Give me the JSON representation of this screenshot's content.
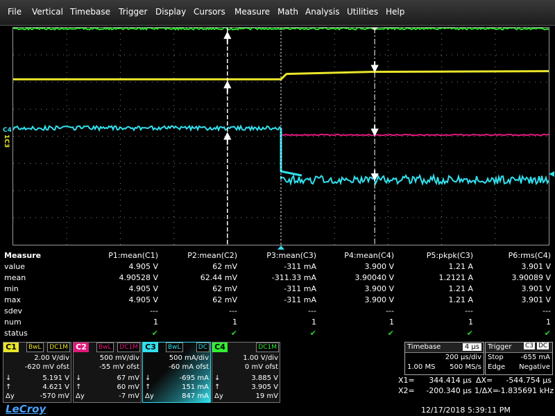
{
  "menu": [
    "File",
    "Vertical",
    "Timebase",
    "Trigger",
    "Display",
    "Cursors",
    "Measure",
    "Math",
    "Analysis",
    "Utilities",
    "Help"
  ],
  "grid": {
    "rows": 8,
    "cols": 10,
    "axis_label_c4": "C4",
    "axis_label_c1c3": "1C3",
    "trigger_marker": "trigger-arrow"
  },
  "waveforms": {
    "c2": {
      "color": "#33ee33",
      "level_div": 0.03
    },
    "c1": {
      "color": "#e9e52a",
      "before_div": 1.9,
      "after_div": 1.6
    },
    "c3": {
      "color": "#33e0ee",
      "before_div": 3.7,
      "after_div": 5.6
    },
    "c4": {
      "color": "#e0187a",
      "level_div": 3.95
    },
    "trigger_time_div": 5.0,
    "cursor1_div": 4.0,
    "cursor2_div": 6.75
  },
  "measure": {
    "title": "Measure",
    "headers": [
      "P1:mean(C1)",
      "P2:mean(C2)",
      "P3:mean(C3)",
      "P4:mean(C4)",
      "P5:pkpk(C3)",
      "P6:rms(C4)"
    ],
    "rows": [
      {
        "label": "value",
        "cells": [
          "4.905 V",
          "62 mV",
          "-311 mA",
          "3.900 V",
          "1.21 A",
          "3.901 V"
        ]
      },
      {
        "label": "mean",
        "cells": [
          "4.90528 V",
          "62.44 mV",
          "-311.33 mA",
          "3.90040 V",
          "1.2121 A",
          "3.90089 V"
        ]
      },
      {
        "label": "min",
        "cells": [
          "4.905 V",
          "62 mV",
          "-311 mA",
          "3.900 V",
          "1.21 A",
          "3.901 V"
        ]
      },
      {
        "label": "max",
        "cells": [
          "4.905 V",
          "62 mV",
          "-311 mA",
          "3.900 V",
          "1.21 A",
          "3.901 V"
        ]
      },
      {
        "label": "sdev",
        "cells": [
          "---",
          "---",
          "---",
          "---",
          "---",
          "---"
        ]
      },
      {
        "label": "num",
        "cells": [
          "1",
          "1",
          "1",
          "1",
          "1",
          "1"
        ]
      },
      {
        "label": "status",
        "cells": [
          "✔",
          "✔",
          "✔",
          "✔",
          "✔",
          "✔"
        ]
      }
    ]
  },
  "channels": [
    {
      "tag": "C1",
      "color": "#e9e52a",
      "bwl": "BwL",
      "coupling": "DC1M",
      "vdiv": "2.00 V/div",
      "ofst": "-620 mV ofst",
      "down": "5.191 V",
      "up": "4.621 V",
      "dy": "-570 mV"
    },
    {
      "tag": "C2",
      "color": "#e0187a",
      "bwl": "BwL",
      "coupling": "DC1M",
      "vdiv": "500 mV/div",
      "ofst": "-55 mV ofst",
      "down": "67 mV",
      "up": "60 mV",
      "dy": "-7 mV"
    },
    {
      "tag": "C3",
      "color": "#33e0ee",
      "bwl": "BwL",
      "coupling": "DC",
      "vdiv": "500 mA/div",
      "ofst": "-60 mA ofst",
      "down": "-695 mA",
      "up": "151 mA",
      "dy": "847 mA"
    },
    {
      "tag": "C4",
      "color": "#33ee33",
      "bwl": "",
      "coupling": "DC1M",
      "vdiv": "1.00 V/div",
      "ofst": "0 mV ofst",
      "down": "3.885 V",
      "up": "3.905 V",
      "dy": "19 mV"
    }
  ],
  "timebase": {
    "title": "Timebase",
    "value": "4 µs",
    "line1": "200 µs/div",
    "line2a": "1.00 MS",
    "line2b": "500 MS/s"
  },
  "trigger": {
    "title": "Trigger",
    "src": "C3",
    "coupling": "DC",
    "line1a": "Stop",
    "line1b": "-655 mA",
    "line2a": "Edge",
    "line2b": "Negative"
  },
  "cursors": {
    "x1_label": "X1=",
    "x1": "344.414 µs",
    "dx_label": "ΔX=",
    "dx": "-544.754 µs",
    "x2_label": "X2=",
    "x2": "-200.340 µs",
    "inv_label": "1/ΔX=",
    "inv": "-1.835691 kHz"
  },
  "footer": {
    "brand": "LeCroy",
    "datetime": "12/17/2018 5:39:11 PM"
  }
}
